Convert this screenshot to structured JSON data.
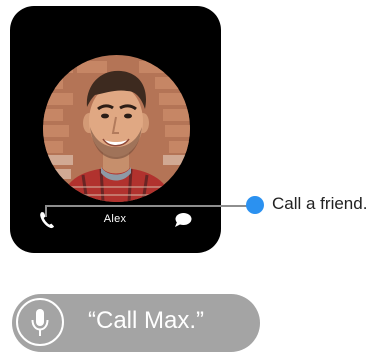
{
  "watch": {
    "contact_name": "Alex",
    "icons": {
      "left": "phone-icon",
      "right": "message-bubble-icon"
    }
  },
  "callout": {
    "text": "Call a friend.",
    "dot_color": "#2b91f0"
  },
  "siri": {
    "icon": "microphone-icon",
    "text": "“Call Max.”"
  },
  "colors": {
    "screen_background": "#000000",
    "pill_background": "#a4a4a4",
    "callout_line": "#8e8e8e"
  }
}
